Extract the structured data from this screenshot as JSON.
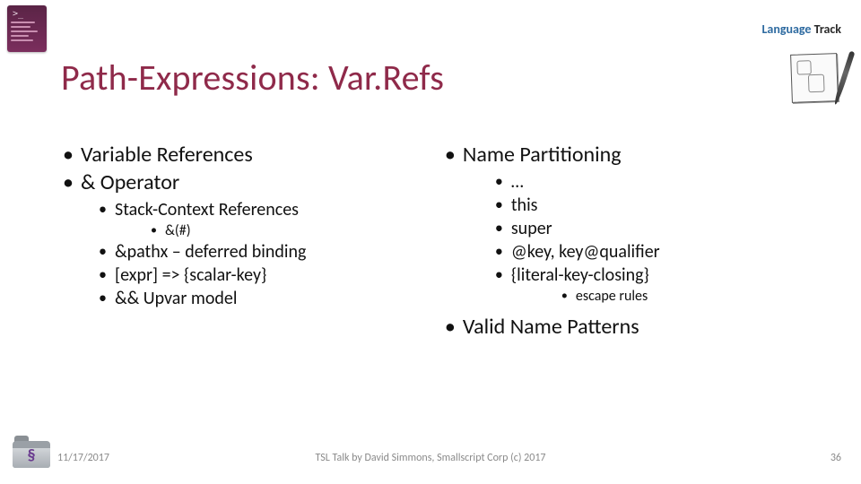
{
  "header": {
    "track_blue": "Language ",
    "track_dark": "Track"
  },
  "title": "Path-Expressions: Var.Refs",
  "left": {
    "items": [
      "Variable References",
      "& Operator"
    ],
    "sub": {
      "items": [
        "Stack-Context References"
      ],
      "sub_sub": [
        "&(#)"
      ],
      "continued": [
        "&pathx – deferred binding",
        "[expr] => {scalar-key}",
        "&& Upvar model"
      ]
    }
  },
  "right": {
    "top": "Name Partitioning",
    "top_children": [
      "…",
      "this",
      "super",
      "@key, key@qualifier",
      "{literal-key-closing}"
    ],
    "top_grand": [
      "escape rules"
    ],
    "second": "Valid Name Patterns"
  },
  "footer": {
    "date": "11/17/2017",
    "credit": "TSL Talk by David Simmons, Smallscript Corp (c) 2017",
    "page": "36"
  }
}
